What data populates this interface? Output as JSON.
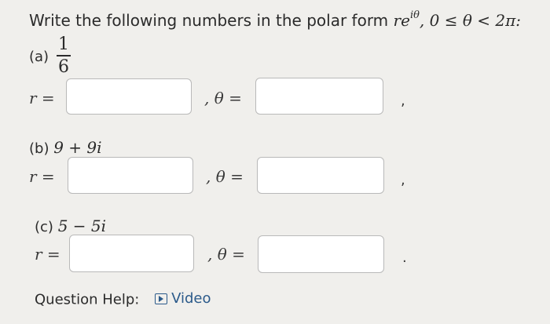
{
  "question": {
    "title_prefix": "Write the following numbers in the polar form ",
    "title_r": "r",
    "title_e": "e",
    "title_exp": "iθ",
    "title_suffix": ", 0 ≤ θ < 2π:"
  },
  "parts": [
    {
      "label": "(a)",
      "fraction": {
        "numerator": "1",
        "denominator": "6"
      },
      "r_label": "r =",
      "sep": ", θ =",
      "tail": ",",
      "r_value": "",
      "theta_value": ""
    },
    {
      "label": "(b)",
      "expression": "9 + 9i",
      "r_label": "r =",
      "sep": ", θ =",
      "tail": ",",
      "r_value": "",
      "theta_value": ""
    },
    {
      "label": "(c)",
      "expression": "5 − 5i",
      "r_label": "r =",
      "sep": ", θ =",
      "tail": ".",
      "r_value": "",
      "theta_value": ""
    }
  ],
  "help": {
    "label": "Question Help:",
    "video_label": "Video",
    "icon": "video-icon"
  },
  "colors": {
    "background": "#f0efec",
    "link": "#2b5a8a",
    "input_border": "#b9b9b9"
  }
}
